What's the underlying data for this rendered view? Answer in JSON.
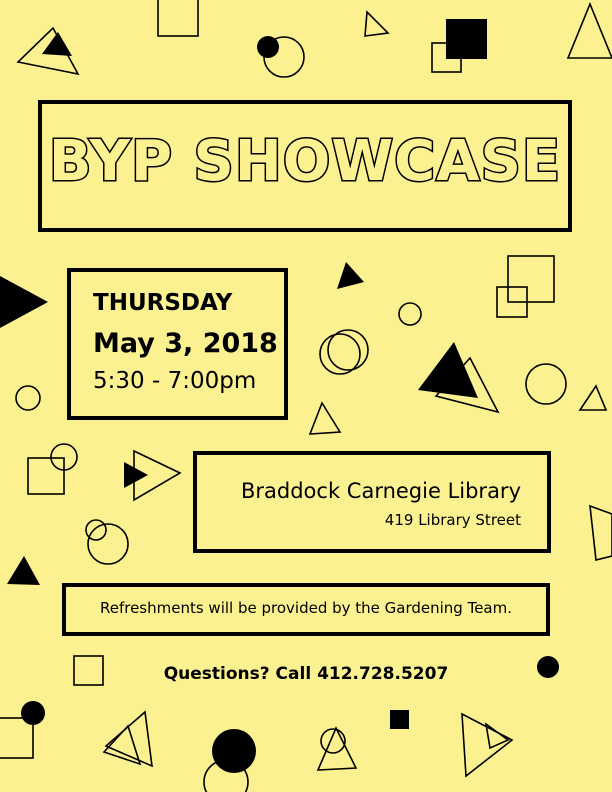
{
  "event": {
    "title": "BYP SHOWCASE",
    "day": "THURSDAY",
    "date": "May 3, 2018",
    "time": "5:30 - 7:00pm"
  },
  "venue": {
    "name": "Braddock Carnegie Library",
    "address": "419 Library Street"
  },
  "notice": "Refreshments will be provided by the Gardening Team.",
  "contact": "Questions? Call 412.728.5207",
  "colors": {
    "background": "#fbf190",
    "ink": "#000000"
  },
  "decoration": {
    "shape_kinds": [
      "triangle-outline",
      "triangle-solid",
      "circle-outline",
      "circle-solid",
      "square-outline",
      "square-solid"
    ]
  }
}
